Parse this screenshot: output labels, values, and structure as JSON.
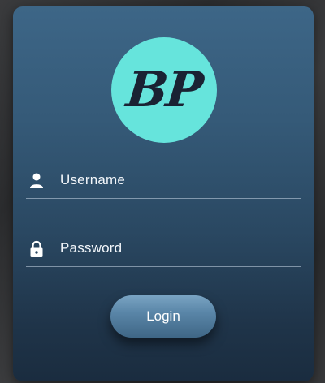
{
  "logo": {
    "text": "BP",
    "circle_color": "#66e4dc",
    "text_color": "#1a2233"
  },
  "form": {
    "username": {
      "placeholder": "Username",
      "icon": "user-icon"
    },
    "password": {
      "placeholder": "Password",
      "icon": "lock-icon"
    },
    "login_label": "Login"
  },
  "colors": {
    "card_top": "#3d6687",
    "card_bottom": "#1a2c3f",
    "button": "#5a86a8"
  }
}
